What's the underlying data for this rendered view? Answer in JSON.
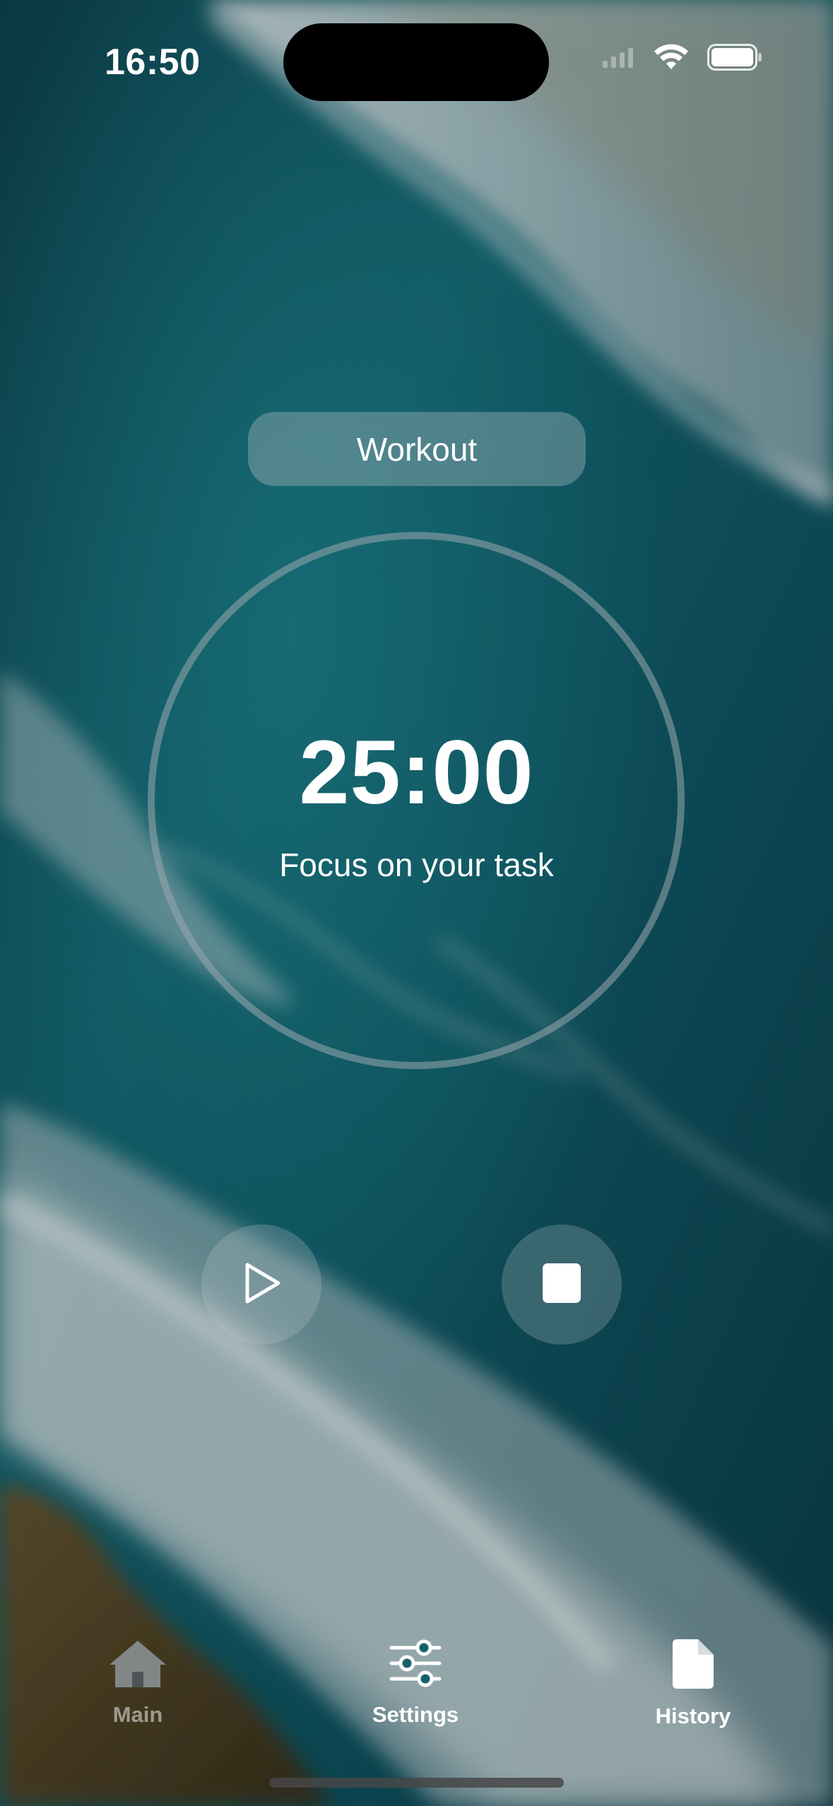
{
  "status_bar": {
    "time": "16:50"
  },
  "preset": {
    "label": "Workout"
  },
  "timer": {
    "value": "25:00",
    "caption": "Focus on your task"
  },
  "controls": {
    "play_icon": "play-icon",
    "stop_icon": "stop-icon"
  },
  "tab_bar": {
    "tabs": [
      {
        "label": "Main",
        "icon": "house-icon",
        "active": false
      },
      {
        "label": "Settings",
        "icon": "sliders-icon",
        "active": true
      },
      {
        "label": "History",
        "icon": "document-icon",
        "active": true
      }
    ]
  },
  "colors": {
    "sea_dark": "#0b3c47",
    "sea_teal": "#14707c",
    "foam": "#c9d3d6",
    "rock": "#5a4322"
  }
}
